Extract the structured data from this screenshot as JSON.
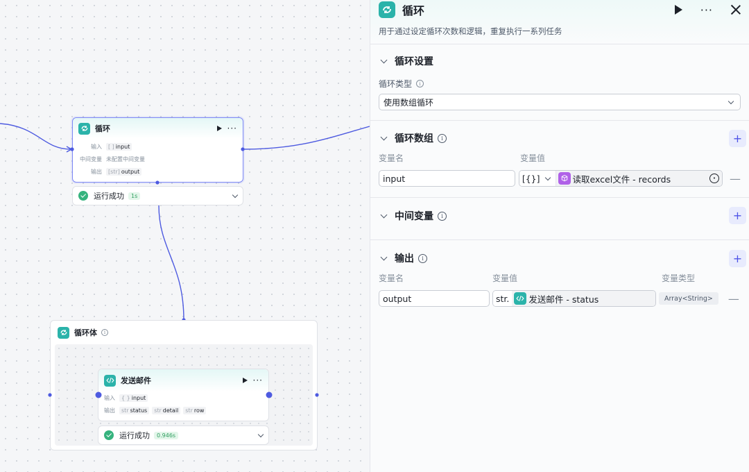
{
  "canvas": {
    "loop_node": {
      "title": "循环",
      "input_label": "输入",
      "input_type": "[ ]",
      "input_name": "input",
      "mid_label": "中间变量",
      "mid_value": "未配置中间变量",
      "output_label": "输出",
      "output_type": "[str]",
      "output_name": "output"
    },
    "loop_status": {
      "text": "运行成功",
      "time": "1s"
    },
    "loop_body": {
      "title": "循环体",
      "child": {
        "title": "发送邮件",
        "input_label": "输入",
        "input_type": "{ }",
        "input_name": "input",
        "output_label": "输出",
        "outputs": [
          {
            "type": "str",
            "name": "status"
          },
          {
            "type": "str",
            "name": "detail"
          },
          {
            "type": "str",
            "name": "row"
          }
        ]
      },
      "child_status": {
        "text": "运行成功",
        "time": "0.946s"
      }
    }
  },
  "panel": {
    "title": "循环",
    "description": "用于通过设定循环次数和逻辑，重复执行一系列任务",
    "loop_settings": {
      "title": "循环设置",
      "type_label": "循环类型",
      "type_value": "使用数组循环"
    },
    "loop_array": {
      "title": "循环数组",
      "col_name": "变量名",
      "col_value": "变量值",
      "var_name": "input",
      "type_glyph": "[{}]",
      "ref_text": "读取excel文件 - records"
    },
    "intermediate": {
      "title": "中间变量"
    },
    "output": {
      "title": "输出",
      "col_name": "变量名",
      "col_value": "变量值",
      "col_type": "变量类型",
      "var_name": "output",
      "type_prefix": "str.",
      "ref_text": "发送邮件 - status",
      "var_type": "Array<String>"
    },
    "plus_glyph": "+",
    "minus_glyph": "—"
  },
  "colors": {
    "accent": "#4d53e8",
    "teal": "#2bb3aa",
    "success": "#36b37e",
    "edge": "#4d5ae0"
  },
  "icons": [
    "loop-icon",
    "play-icon",
    "more-icon",
    "close-icon",
    "code-icon",
    "cube-icon",
    "check-icon",
    "info-icon",
    "chevron-down-icon",
    "plus-icon",
    "minus-icon"
  ]
}
